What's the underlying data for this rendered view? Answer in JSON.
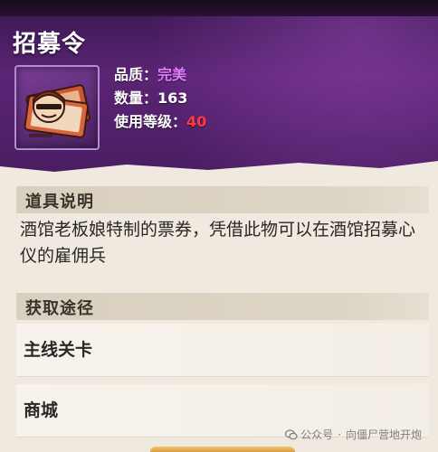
{
  "item": {
    "title": "招募令",
    "icon": "recruitment-ticket-icon",
    "quality": {
      "label": "品质：",
      "value": "完美"
    },
    "quantity": {
      "label": "数量：",
      "value": "163"
    },
    "use_level": {
      "label": "使用等级：",
      "value": "40"
    }
  },
  "description": {
    "header": "道具说明",
    "text": "酒馆老板娘特制的票券，凭借此物可以在酒馆招募心仪的雇佣兵"
  },
  "sources": {
    "header": "获取途径",
    "items": [
      {
        "label": "主线关卡"
      },
      {
        "label": "商城"
      }
    ]
  },
  "watermark": {
    "account_prefix": "公众号",
    "separator": "·",
    "account_name": "向僵尸营地开炮",
    "icon": "wechat-icon"
  },
  "colors": {
    "header_purple": "#5b2475",
    "quality_purple": "#e27cff",
    "level_red": "#ff3b3b",
    "panel_beige": "#efe9df"
  }
}
